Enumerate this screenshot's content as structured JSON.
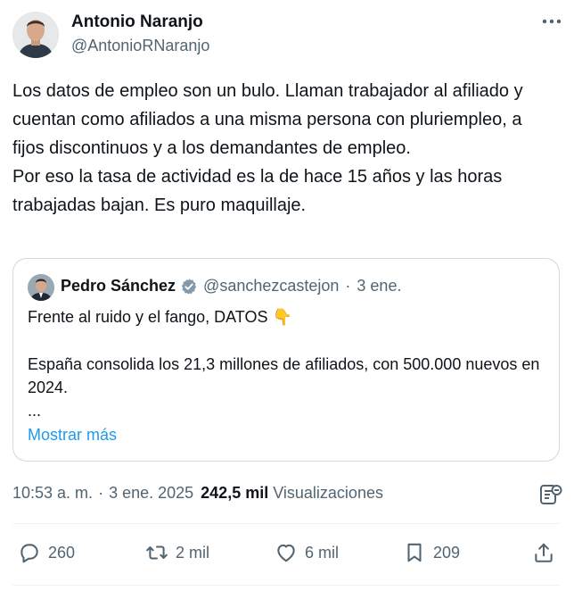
{
  "author": {
    "name": "Antonio Naranjo",
    "handle": "@AntonioRNaranjo"
  },
  "tweet": {
    "paragraphs": [
      "Los datos de empleo son un bulo. Llaman trabajador al afiliado y cuentan como afiliados a una misma persona con pluriempleo, a fijos discontinuos y a los demandantes de empleo.",
      "Por eso la tasa de actividad es la de hace 15 años y las horas trabajadas bajan. Es puro maquillaje."
    ]
  },
  "quote": {
    "name": "Pedro Sánchez",
    "handle": "@sanchezcastejon",
    "separator": "·",
    "date": "3 ene.",
    "line1": "Frente al ruido y el fango, DATOS",
    "emoji": "👇",
    "line2": "España consolida los 21,3 millones de afiliados, con 500.000 nuevos en 2024.",
    "ellipsis": "...",
    "show_more": "Mostrar más"
  },
  "meta": {
    "time": "10:53 a. m.",
    "separator": "·",
    "date": "3 ene. 2025",
    "views_count": "242,5 mil",
    "views_label": "Visualizaciones"
  },
  "actions": {
    "replies": "260",
    "reposts": "2 mil",
    "likes": "6 mil",
    "bookmarks": "209"
  },
  "colors": {
    "text": "#0f1419",
    "secondary": "#536471",
    "link": "#1d9bf0",
    "border": "#cfd9de",
    "verified": "#829aab"
  }
}
